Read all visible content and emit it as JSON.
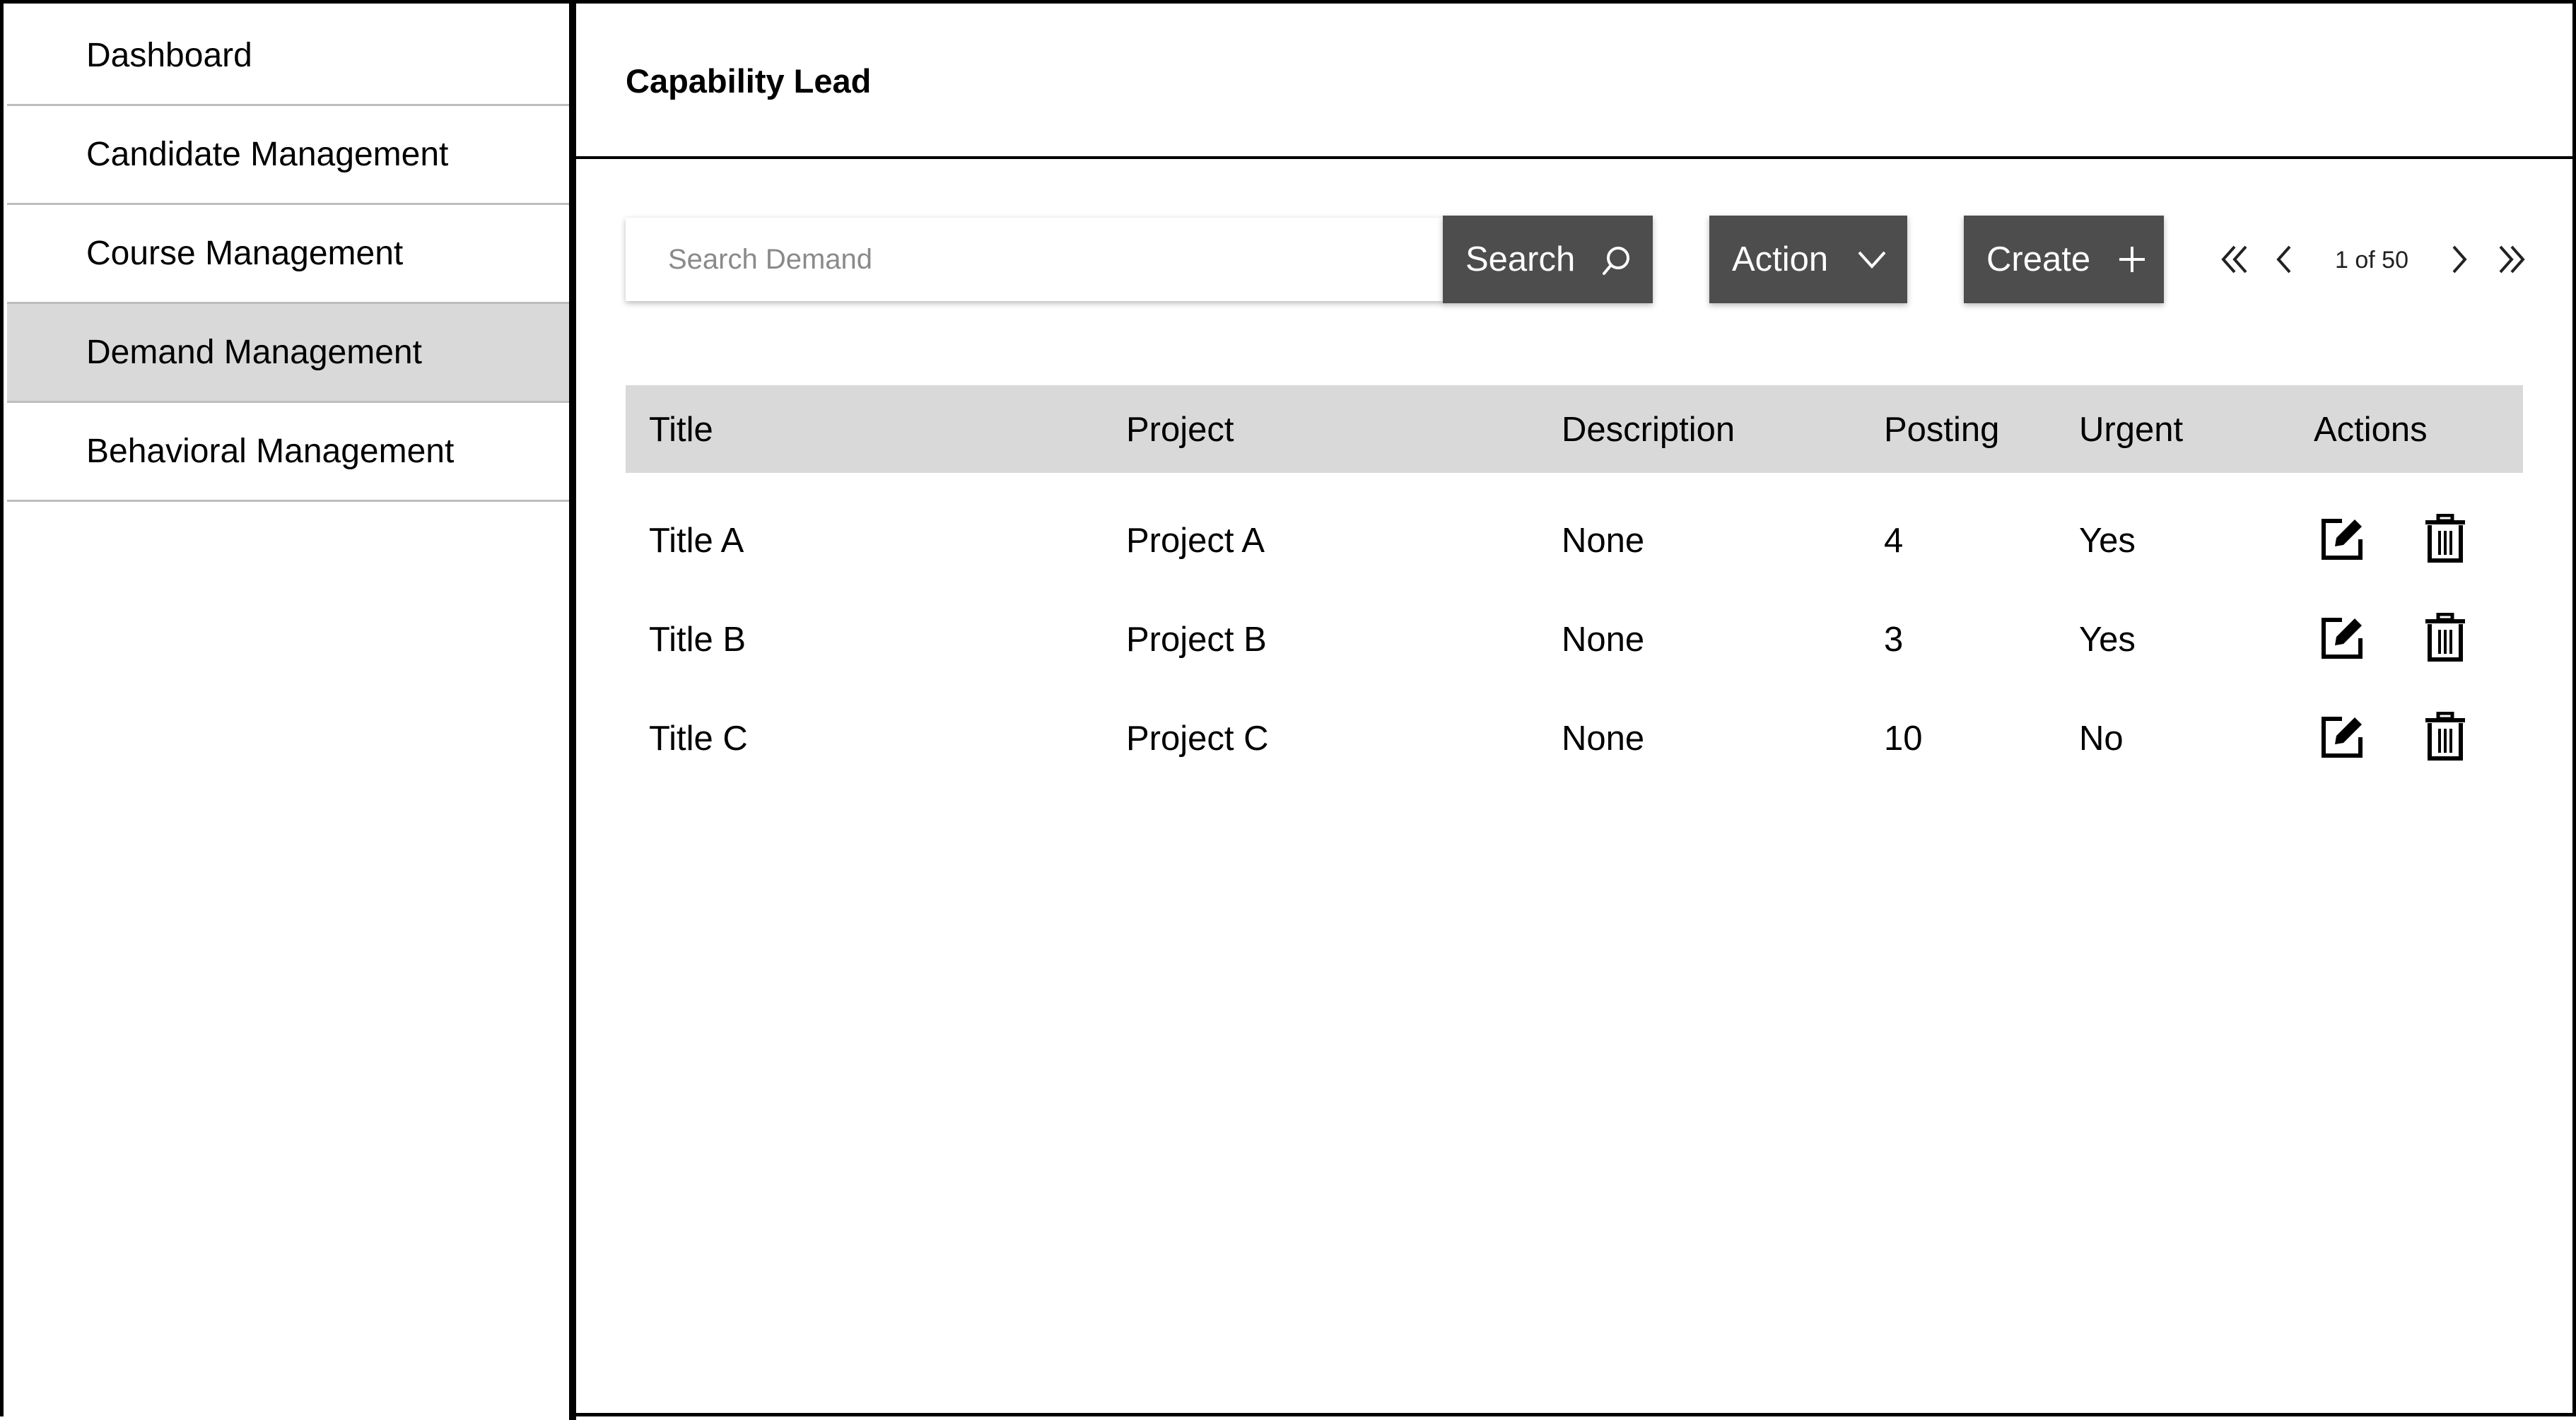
{
  "sidebar": {
    "items": [
      {
        "label": "Dashboard",
        "active": false
      },
      {
        "label": "Candidate Management",
        "active": false
      },
      {
        "label": "Course Management",
        "active": false
      },
      {
        "label": "Demand Management",
        "active": true
      },
      {
        "label": "Behavioral Management",
        "active": false
      }
    ]
  },
  "header": {
    "title": "Capability Lead"
  },
  "toolbar": {
    "search_placeholder": "Search Demand",
    "search_value": "",
    "search_label": "Search",
    "search_icon": "search-icon",
    "action_label": "Action",
    "action_icon": "chevron-down-icon",
    "create_label": "Create",
    "create_icon": "plus-icon"
  },
  "pagination": {
    "text": "1 of 50",
    "current_page": 1,
    "total_pages": 50
  },
  "table": {
    "columns": [
      "Title",
      "Project",
      "Description",
      "Posting",
      "Urgent",
      "Actions"
    ],
    "rows": [
      {
        "title": "Title A",
        "project": "Project A",
        "description": "None",
        "posting": "4",
        "urgent": "Yes"
      },
      {
        "title": "Title B",
        "project": "Project B",
        "description": "None",
        "posting": "3",
        "urgent": "Yes"
      },
      {
        "title": "Title C",
        "project": "Project C",
        "description": "None",
        "posting": "10",
        "urgent": "No"
      }
    ],
    "row_actions": [
      "edit-icon",
      "delete-icon"
    ]
  },
  "colors": {
    "button_bg": "#4d4d4d",
    "active_nav_bg": "#d9d9d9",
    "table_header_bg": "#d9d9d9",
    "divider": "#bdbdbd"
  }
}
